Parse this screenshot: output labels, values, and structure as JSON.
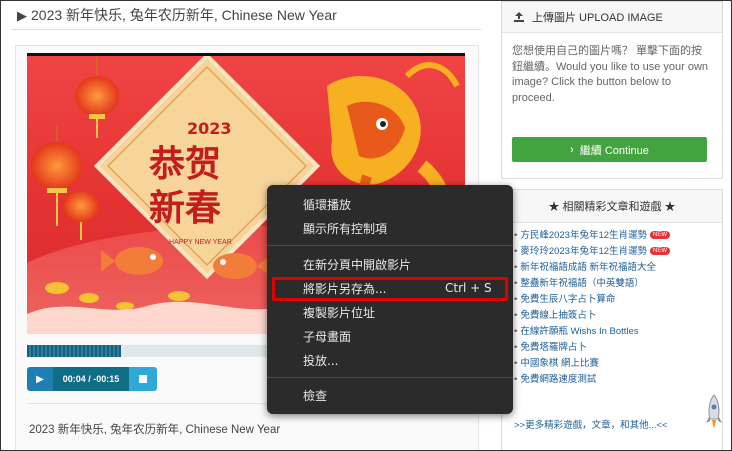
{
  "page": {
    "title": "2023 新年快乐, 兔年农历新年, Chinese New Year",
    "caption": "2023 新年快乐, 兔年农历新年, Chinese New Year"
  },
  "video": {
    "poster": {
      "year": "2023",
      "line1": "恭贺",
      "line2": "新春",
      "subtitle": "HAPPY NEW YEAR"
    },
    "time_display": "00:04 / -00:15",
    "progress_buffered_fraction": 0.39
  },
  "upload_panel": {
    "heading": "上傳圖片 UPLOAD IMAGE",
    "body": "您想使用自己的圖片嗎？ 單擊下面的按鈕繼續。Would you like to use your own image? Click the button below to proceed.",
    "button": "繼續 Continue"
  },
  "related_panel": {
    "heading": "★ 相關精彩文章和遊戲 ★",
    "items": [
      {
        "label": "方民峰2023年兔年12生肖運勢",
        "hot": "NEW"
      },
      {
        "label": "麥玲玲2023年兔年12生肖運勢",
        "hot": "NEW"
      },
      {
        "label": "新年祝福語成語 新年祝福語大全",
        "hot": ""
      },
      {
        "label": "整蠱新年祝福語（中英雙語）",
        "hot": ""
      },
      {
        "label": "免費生辰八字占卜算命",
        "hot": ""
      },
      {
        "label": "免費線上抽簽占卜",
        "hot": ""
      },
      {
        "label": "在線許願瓶 Wishs In Bottles",
        "hot": ""
      },
      {
        "label": "免費塔羅牌占卜",
        "hot": ""
      },
      {
        "label": "中國象棋 網上比賽",
        "hot": ""
      },
      {
        "label": "免費網路速度測試",
        "hot": ""
      }
    ],
    "more": ">>更多精彩遊戲，文章，和其他...<<"
  },
  "context_menu": {
    "items": [
      {
        "label": "循環播放",
        "shortcut": ""
      },
      {
        "label": "顯示所有控制項",
        "shortcut": ""
      },
      {
        "label": "在新分頁中開啟影片",
        "shortcut": ""
      },
      {
        "label": "將影片另存為...",
        "shortcut": "Ctrl + S"
      },
      {
        "label": "複製影片位址",
        "shortcut": ""
      },
      {
        "label": "子母畫面",
        "shortcut": ""
      },
      {
        "label": "投放...",
        "shortcut": ""
      },
      {
        "label": "檢查",
        "shortcut": ""
      }
    ],
    "highlighted_item": "將影片另存為..."
  },
  "colors": {
    "continue_button": "#43a43f",
    "link": "#1e5f9a",
    "menu_bg": "#2b2b2b",
    "highlight_border": "#e00000"
  }
}
